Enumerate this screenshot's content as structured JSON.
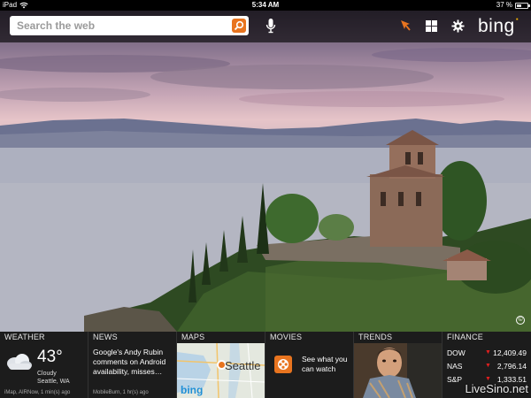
{
  "status_bar": {
    "device": "iPad",
    "time": "5:34 AM",
    "battery": "37 %"
  },
  "search": {
    "placeholder": "Search the web"
  },
  "brand": {
    "logo_text": "bing"
  },
  "panels": {
    "weather": {
      "title": "WEATHER",
      "temperature": "43°",
      "condition": "Cloudy",
      "location": "Seattle, WA",
      "source": "iMap, AIRNow, 1 min(s) ago"
    },
    "news": {
      "title": "NEWS",
      "headline": "Google's Andy Rubin comments on Android availability, misses…",
      "source": "MobileBurn, 1 hr(s) ago"
    },
    "maps": {
      "title": "MAPS",
      "city": "Seattle",
      "logo": "bing"
    },
    "movies": {
      "title": "MOVIES",
      "text": "See what you can watch"
    },
    "trends": {
      "title": "TRENDS"
    },
    "finance": {
      "title": "FINANCE",
      "rows": [
        {
          "symbol": "DOW",
          "value": "12,409.49",
          "direction": "down"
        },
        {
          "symbol": "NAS",
          "value": "2,796.14",
          "direction": "down"
        },
        {
          "symbol": "S&P",
          "value": "1,333.51",
          "direction": "down"
        }
      ],
      "watermark": "LiveSino.net"
    }
  },
  "colors": {
    "accent": "#e8741f",
    "down_arrow": "#e01f1f"
  },
  "icons": [
    "wifi-icon",
    "battery-icon",
    "search-icon",
    "microphone-icon",
    "location-arrow-icon",
    "apps-grid-icon",
    "gear-icon",
    "cloud-icon",
    "map-pin-icon",
    "film-reel-icon",
    "copyright-icon"
  ]
}
